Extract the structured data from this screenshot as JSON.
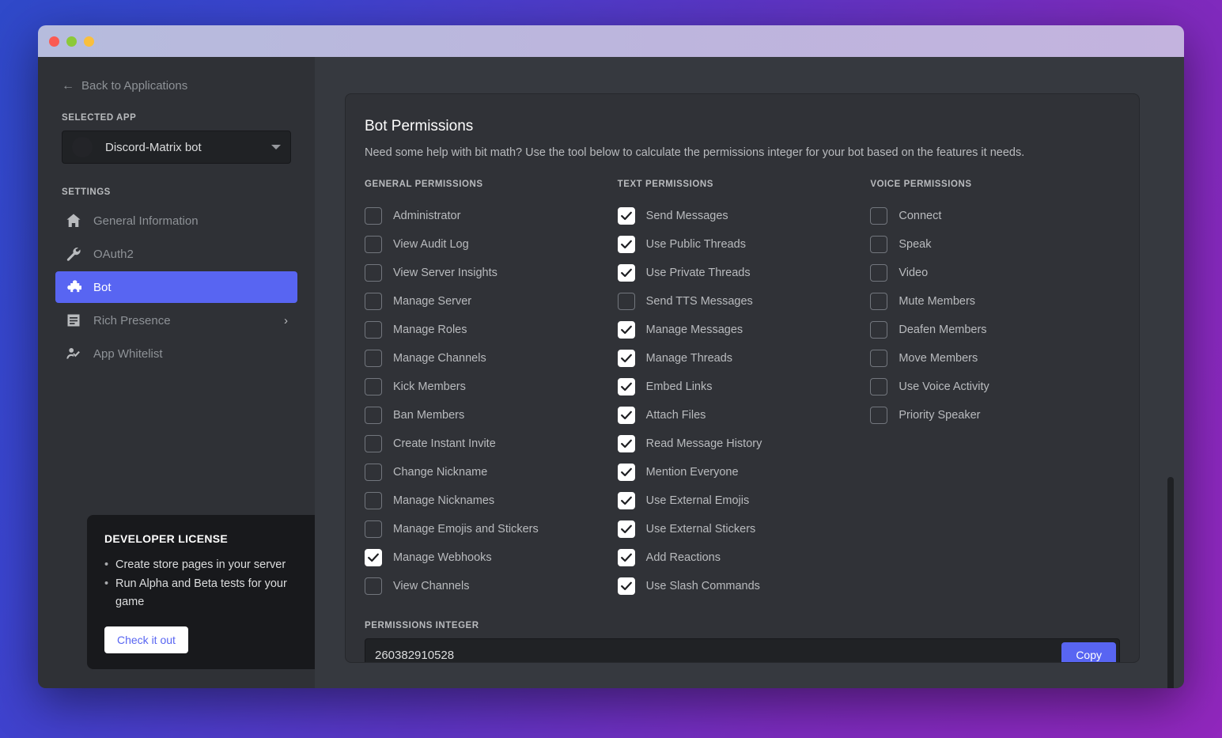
{
  "window": {
    "traffic_lights": [
      "close",
      "minimize",
      "maximize"
    ]
  },
  "sidebar": {
    "back_label": "Back to Applications",
    "back_icon": "arrow-left-icon",
    "selected_app_label": "SELECTED APP",
    "selected_app_name": "Discord-Matrix bot",
    "settings_label": "SETTINGS",
    "items": [
      {
        "label": "General Information",
        "icon": "home-icon",
        "active": false,
        "chevron": ""
      },
      {
        "label": "OAuth2",
        "icon": "wrench-icon",
        "active": false,
        "chevron": ""
      },
      {
        "label": "Bot",
        "icon": "puzzle-icon",
        "active": true,
        "chevron": ""
      },
      {
        "label": "Rich Presence",
        "icon": "document-icon",
        "active": false,
        "chevron": "›"
      },
      {
        "label": "App Whitelist",
        "icon": "person-check-icon",
        "active": false,
        "chevron": ""
      }
    ],
    "license_card": {
      "title": "DEVELOPER LICENSE",
      "bullets": [
        "Create store pages in your server",
        "Run Alpha and Beta tests for your game"
      ],
      "button_label": "Check it out"
    }
  },
  "main": {
    "title": "Bot Permissions",
    "description": "Need some help with bit math? Use the tool below to calculate the permissions integer for your bot based on the features it needs.",
    "columns": [
      {
        "title": "GENERAL PERMISSIONS",
        "items": [
          {
            "label": "Administrator",
            "checked": false
          },
          {
            "label": "View Audit Log",
            "checked": false
          },
          {
            "label": "View Server Insights",
            "checked": false
          },
          {
            "label": "Manage Server",
            "checked": false
          },
          {
            "label": "Manage Roles",
            "checked": false
          },
          {
            "label": "Manage Channels",
            "checked": false
          },
          {
            "label": "Kick Members",
            "checked": false
          },
          {
            "label": "Ban Members",
            "checked": false
          },
          {
            "label": "Create Instant Invite",
            "checked": false
          },
          {
            "label": "Change Nickname",
            "checked": false
          },
          {
            "label": "Manage Nicknames",
            "checked": false
          },
          {
            "label": "Manage Emojis and Stickers",
            "checked": false
          },
          {
            "label": "Manage Webhooks",
            "checked": true
          },
          {
            "label": "View Channels",
            "checked": false
          }
        ]
      },
      {
        "title": "TEXT PERMISSIONS",
        "items": [
          {
            "label": "Send Messages",
            "checked": true
          },
          {
            "label": "Use Public Threads",
            "checked": true
          },
          {
            "label": "Use Private Threads",
            "checked": true
          },
          {
            "label": "Send TTS Messages",
            "checked": false
          },
          {
            "label": "Manage Messages",
            "checked": true
          },
          {
            "label": "Manage Threads",
            "checked": true
          },
          {
            "label": "Embed Links",
            "checked": true
          },
          {
            "label": "Attach Files",
            "checked": true
          },
          {
            "label": "Read Message History",
            "checked": true
          },
          {
            "label": "Mention Everyone",
            "checked": true
          },
          {
            "label": "Use External Emojis",
            "checked": true
          },
          {
            "label": "Use External Stickers",
            "checked": true
          },
          {
            "label": "Add Reactions",
            "checked": true
          },
          {
            "label": "Use Slash Commands",
            "checked": true
          }
        ]
      },
      {
        "title": "VOICE PERMISSIONS",
        "items": [
          {
            "label": "Connect",
            "checked": false
          },
          {
            "label": "Speak",
            "checked": false
          },
          {
            "label": "Video",
            "checked": false
          },
          {
            "label": "Mute Members",
            "checked": false
          },
          {
            "label": "Deafen Members",
            "checked": false
          },
          {
            "label": "Move Members",
            "checked": false
          },
          {
            "label": "Use Voice Activity",
            "checked": false
          },
          {
            "label": "Priority Speaker",
            "checked": false
          }
        ]
      }
    ],
    "integer_label": "PERMISSIONS INTEGER",
    "integer_value": "260382910528",
    "copy_label": "Copy"
  },
  "colors": {
    "accent": "#5865f2",
    "sidebar_bg": "#2f3136",
    "main_bg": "#36393f",
    "panel_bg": "#303237",
    "input_bg": "#202225",
    "text_muted": "#b9bbbe",
    "traffic_red": "#fb5a52",
    "traffic_green": "#8cc938",
    "traffic_yellow": "#f9bf3d"
  }
}
